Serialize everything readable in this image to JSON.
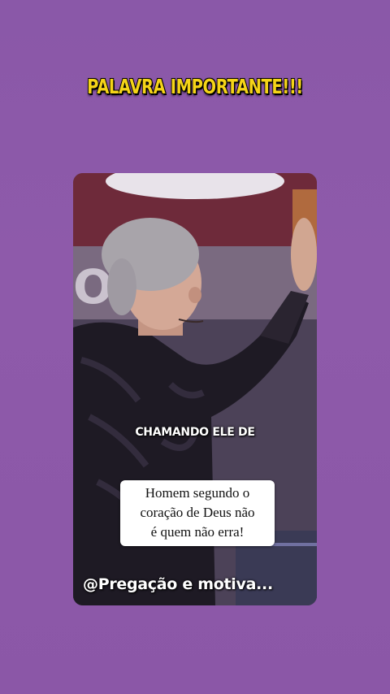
{
  "headline": "PALAVRA IMPORTANTE!!!",
  "video": {
    "caption": "CHAMANDO ELE DE",
    "quote_lines": [
      "Homem segundo o",
      "coração de Deus não",
      "é quem não erra!"
    ],
    "watermark": "@Pregação e motiva..."
  },
  "colors": {
    "background": "#8b57a7",
    "headline": "#f5d418",
    "quote_box": "#ffffff"
  }
}
